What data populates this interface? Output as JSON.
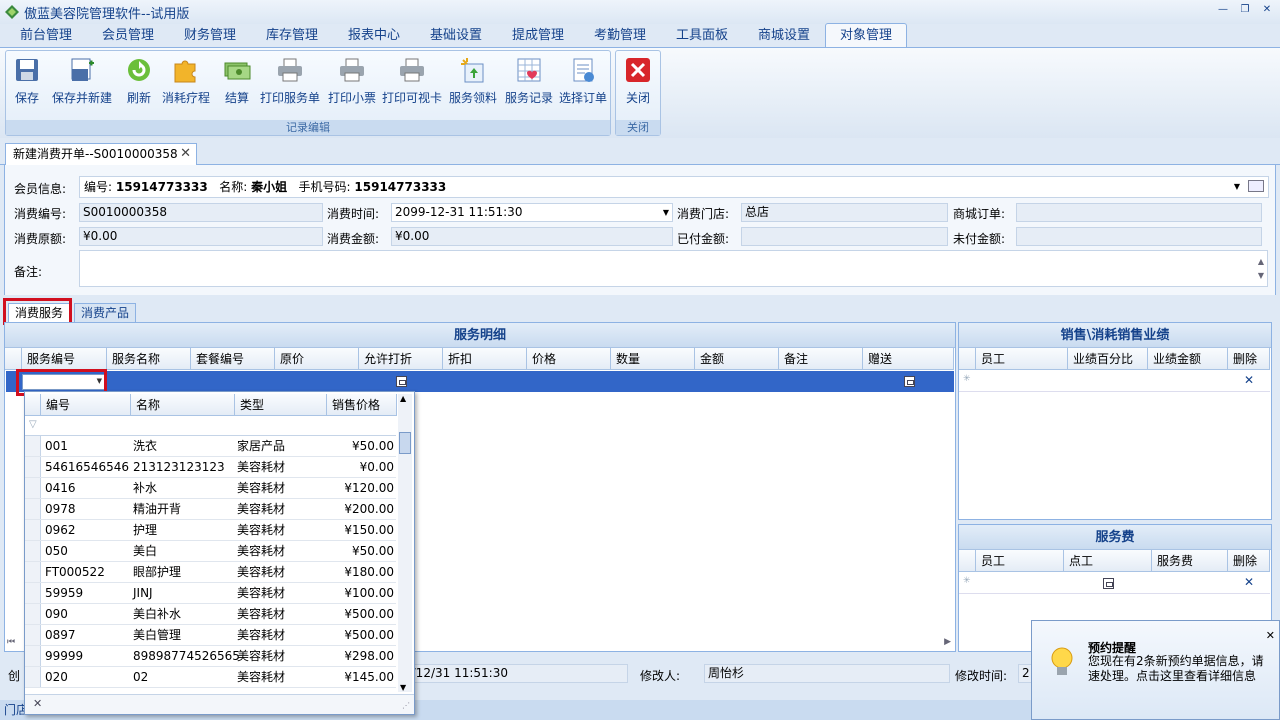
{
  "window": {
    "title": "傲蓝美容院管理软件--试用版"
  },
  "menu_tabs": [
    "前台管理",
    "会员管理",
    "财务管理",
    "库存管理",
    "报表中心",
    "基础设置",
    "提成管理",
    "考勤管理",
    "工具面板",
    "商城设置",
    "对象管理"
  ],
  "ribbon": {
    "group1_label": "记录编辑",
    "group2_label": "关闭",
    "buttons": [
      "保存",
      "保存并新建",
      "刷新",
      "消耗疗程",
      "结算",
      "打印服务单",
      "打印小票",
      "打印可视卡",
      "服务领料",
      "服务记录",
      "选择订单"
    ],
    "close_button": "关闭"
  },
  "doc_tab": {
    "label": "新建消费开单--S0010000358"
  },
  "form": {
    "member_label": "会员信息:",
    "member_info": {
      "id_label": "编号:",
      "id": "15914773333",
      "name_label": "名称:",
      "name": "秦小姐",
      "phone_label": "手机号码:",
      "phone": "15914773333"
    },
    "consume_no_label": "消费编号:",
    "consume_no": "S0010000358",
    "consume_time_label": "消费时间:",
    "consume_time": "2099-12-31 11:51:30",
    "store_label": "消费门店:",
    "store": "总店",
    "mall_order_label": "商城订单:",
    "mall_order": "",
    "original_amount_label": "消费原额:",
    "original_amount": "¥0.00",
    "amount_label": "消费金额:",
    "amount": "¥0.00",
    "paid_label": "已付金额:",
    "paid": "",
    "unpaid_label": "未付金额:",
    "unpaid": "",
    "remark_label": "备注:"
  },
  "sub_tabs": [
    "消费服务",
    "消费产品"
  ],
  "service_panel": {
    "title": "服务明细",
    "columns": [
      "服务编号",
      "服务名称",
      "套餐编号",
      "原价",
      "允许打折",
      "折扣",
      "价格",
      "数量",
      "金额",
      "备注",
      "赠送"
    ]
  },
  "sales_panel": {
    "title": "销售\\消耗销售业绩",
    "columns": [
      "员工",
      "业绩百分比",
      "业绩金额",
      "删除"
    ]
  },
  "fee_panel": {
    "title": "服务费",
    "columns": [
      "员工",
      "点工",
      "服务费",
      "删除"
    ]
  },
  "dropdown": {
    "columns": [
      "编号",
      "名称",
      "类型",
      "销售价格"
    ],
    "rows": [
      [
        "001",
        "洗衣",
        "家居产品",
        "¥50.00"
      ],
      [
        "54616546546",
        "213123123123",
        "美容耗材",
        "¥0.00"
      ],
      [
        "0416",
        "补水",
        "美容耗材",
        "¥120.00"
      ],
      [
        "0978",
        "精油开背",
        "美容耗材",
        "¥200.00"
      ],
      [
        "0962",
        "护理",
        "美容耗材",
        "¥150.00"
      ],
      [
        "050",
        "美白",
        "美容耗材",
        "¥50.00"
      ],
      [
        "FT000522",
        "眼部护理",
        "美容耗材",
        "¥180.00"
      ],
      [
        "59959",
        "JINJ",
        "美容耗材",
        "¥100.00"
      ],
      [
        "090",
        "美白补水",
        "美容耗材",
        "¥500.00"
      ],
      [
        "0897",
        "美白管理",
        "美容耗材",
        "¥500.00"
      ],
      [
        "99999",
        "89898774526565",
        "美容耗材",
        "¥298.00"
      ],
      [
        "020",
        "02",
        "美容耗材",
        "¥145.00"
      ]
    ]
  },
  "footer": {
    "created_prefix": "创",
    "created_time": "9/12/31 11:51:30",
    "modifier_label": "修改人:",
    "modifier": "周怡杉",
    "modify_time_label": "修改时间:",
    "modify_time_partial": "2",
    "bottom_text": "门店"
  },
  "notice": {
    "title": "预约提醒",
    "message": "您现在有2条新预约单据信息，请速处理。点击这里查看详细信息"
  },
  "colors": {
    "accent": "#15428b",
    "selection": "#3266c8",
    "highlight": "#d10f1f"
  }
}
